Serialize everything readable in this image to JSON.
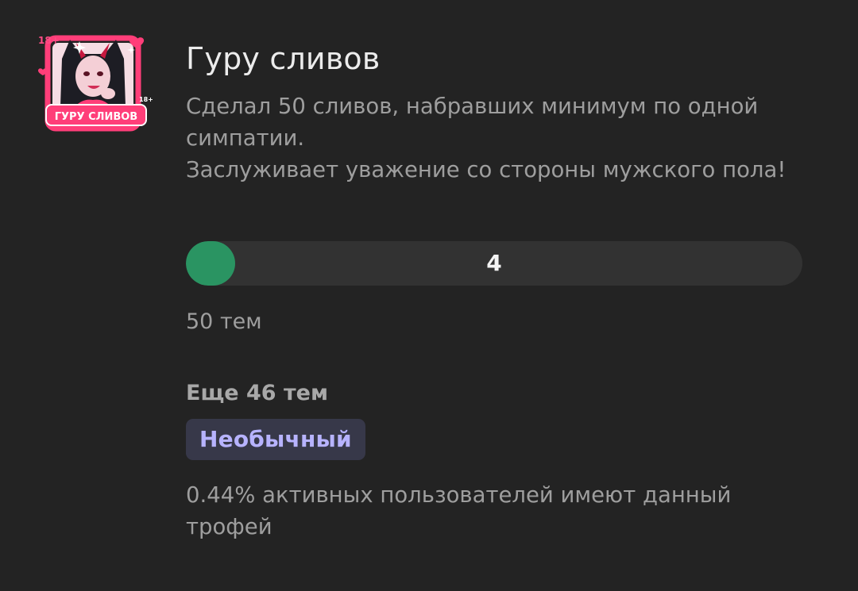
{
  "trophy": {
    "badge": {
      "icon": "trophy-badge-image",
      "caption": "ГУРУ СЛИВОВ",
      "age_marks": [
        "18+",
        "18+"
      ]
    },
    "title": "Гуру сливов",
    "description": [
      "Сделал 50 сливов, набравших минимум по одной",
      "симпатии.",
      "Заслуживает уважение со стороны мужского пола!"
    ],
    "progress": {
      "current": "4",
      "target": 50,
      "fraction": 0.08,
      "fill_color": "#2a9462",
      "goal_label": "50 тем"
    },
    "remaining_label": "Еще 46 тем",
    "rarity": {
      "label": "Необычный",
      "color": "#b7b3ff"
    },
    "stat_text": "0.44% активных пользователей имеют данный трофей"
  }
}
